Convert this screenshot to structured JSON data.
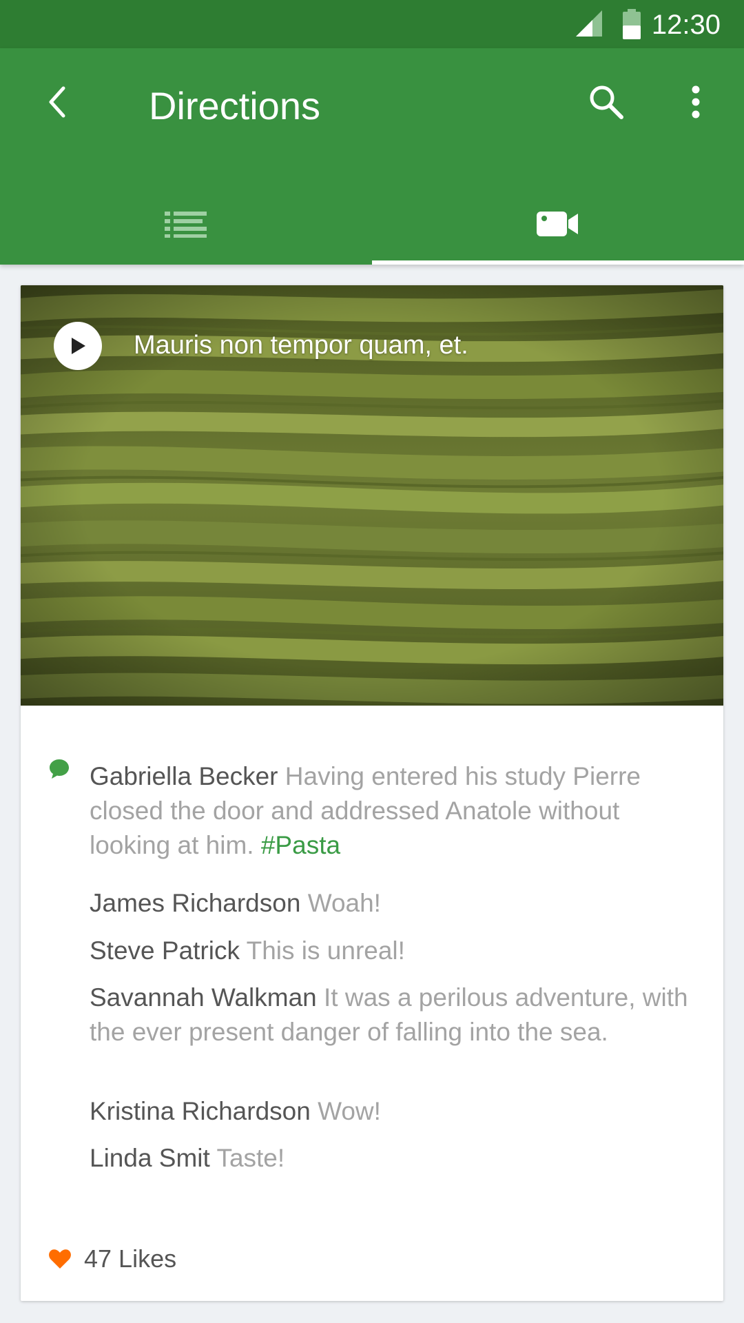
{
  "status_bar": {
    "time": "12:30",
    "icons": [
      "cell-signal-icon",
      "battery-icon"
    ]
  },
  "app_bar": {
    "title": "Directions",
    "back_icon": "back-arrow-icon",
    "actions": [
      "search-icon",
      "more-vert-icon"
    ],
    "tabs": [
      {
        "icon": "list-icon",
        "selected": false
      },
      {
        "icon": "video-camera-icon",
        "selected": true
      }
    ]
  },
  "video": {
    "title": "Mauris non tempor quam, et.",
    "play_icon": "play-icon"
  },
  "comments": [
    {
      "author": "Gabriella Becker",
      "text": "Having entered his study Pierre closed the door and addressed Anatole without looking at him.",
      "hashtag": "#Pasta"
    },
    {
      "author": "James Richardson",
      "text": "Woah!"
    },
    {
      "author": "Steve Patrick",
      "text": "This is unreal!"
    },
    {
      "author": "Savannah Walkman",
      "text": "It was a perilous adventure, with the ever present danger of falling into the sea."
    },
    {
      "author": "Kristina Richardson",
      "text": "Wow!"
    },
    {
      "author": "Linda Smit",
      "text": "Taste!"
    }
  ],
  "likes": {
    "label": "47 Likes",
    "icon": "heart-icon"
  },
  "colors": {
    "status_bar": "#2e7d32",
    "app_bar": "#399140",
    "hashtag": "#3a9b45",
    "heart": "#ff6d00",
    "comment_author": "#555555",
    "comment_text": "#a3a3a3",
    "background": "#eef1f4"
  }
}
